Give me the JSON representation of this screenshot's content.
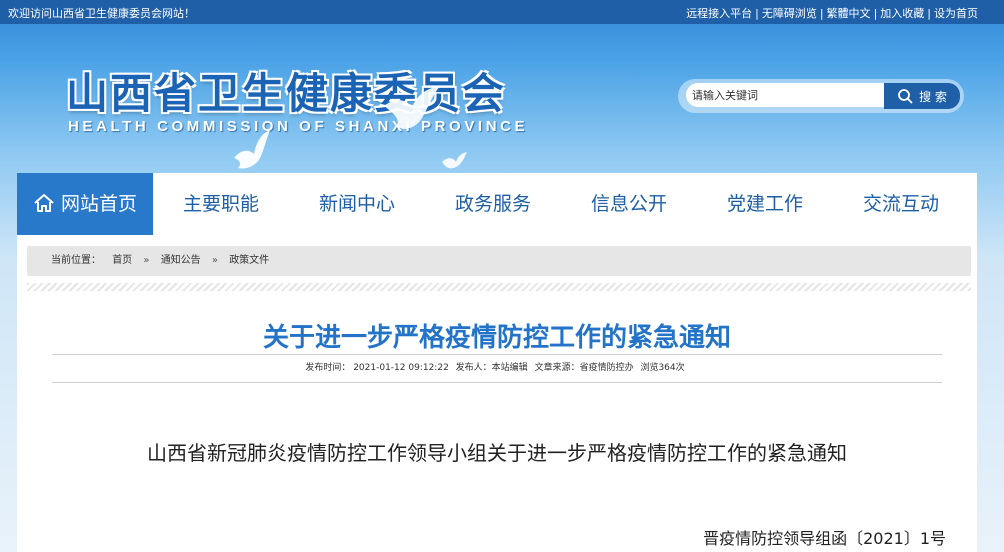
{
  "topbar": {
    "welcome": "欢迎访问山西省卫生健康委员会网站！",
    "links": [
      "远程接入平台",
      "无障碍浏览",
      "繁體中文",
      "加入收藏",
      "设为首页"
    ]
  },
  "header": {
    "title": "山西省卫生健康委员会",
    "subtitle": "HEALTH COMMISSION OF SHANXI PROVINCE"
  },
  "search": {
    "value": "请输入关键词",
    "button_label": "搜 索"
  },
  "nav": {
    "items": [
      {
        "label": "网站首页"
      },
      {
        "label": "主要职能"
      },
      {
        "label": "新闻中心"
      },
      {
        "label": "政务服务"
      },
      {
        "label": "信息公开"
      },
      {
        "label": "党建工作"
      },
      {
        "label": "交流互动"
      }
    ]
  },
  "breadcrumb": {
    "prefix": "当前位置：",
    "items": [
      "首页",
      "通知公告",
      "政策文件"
    ],
    "separator": "»"
  },
  "article": {
    "title": "关于进一步严格疫情防控工作的紧急通知",
    "meta": {
      "publish_time": "发布时间：  2021-01-12 09:12:22",
      "publisher": "发布人：本站编辑",
      "source": "文章来源：省疫情防控办",
      "views": "浏览364次"
    },
    "lead": "山西省新冠肺炎疫情防控工作领导小组关于进一步严格疫情防控工作的紧急通知",
    "doc_number": "晋疫情防控领导组函〔2021〕1号"
  },
  "colors": {
    "topbar_bg": "#1f5fa8",
    "nav_active_bg": "#2879c9",
    "nav_text": "#1d5fa7",
    "title_text": "#2374c8"
  },
  "icons": {
    "nav_home": "home-icon",
    "search": "search-icon",
    "decor": "dove-icon"
  }
}
